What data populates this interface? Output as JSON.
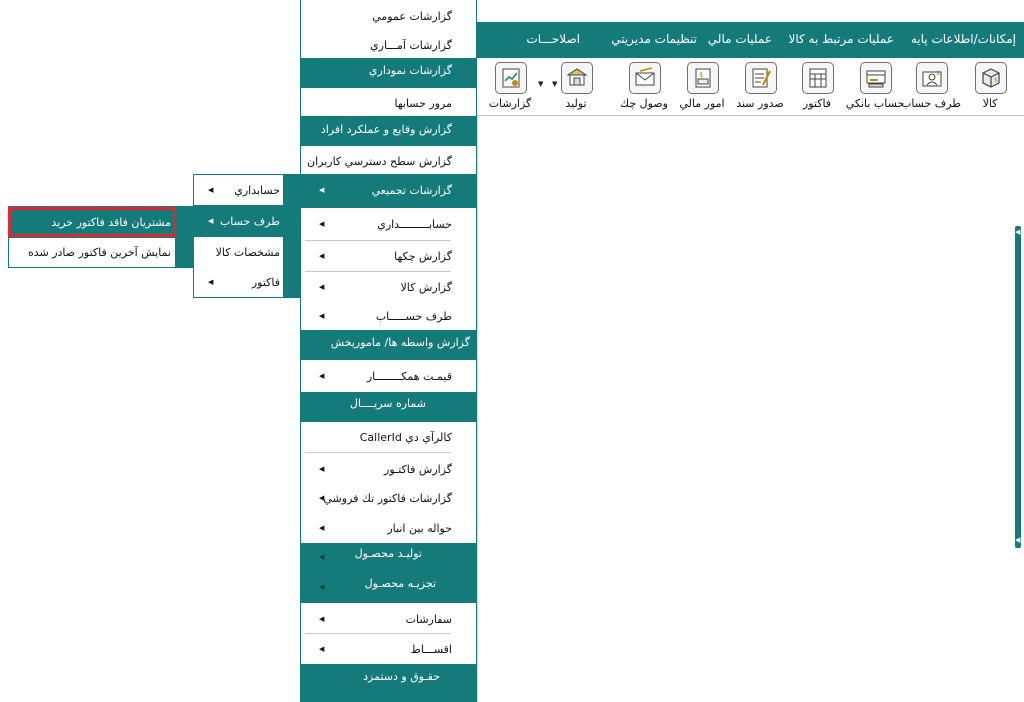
{
  "menubar": {
    "items": [
      "إمكانات/اطلاعات پايه",
      "عمليات مرتبط به كالا",
      "عمليات مالي",
      "تنظيمات مديريتي",
      "اصلاحـــات"
    ]
  },
  "toolbar": {
    "buttons": [
      {
        "label": "كالا",
        "icon": "box-icon"
      },
      {
        "label": "طرف حساب",
        "icon": "person-card-icon"
      },
      {
        "label": "حساب بانكي",
        "icon": "bank-card-icon"
      },
      {
        "label": "فاكتور",
        "icon": "invoice-icon"
      },
      {
        "label": "صدور سند",
        "icon": "document-pen-icon"
      },
      {
        "label": "امور مالي",
        "icon": "finance-icon"
      },
      {
        "label": "وصول چك",
        "icon": "cheque-envelope-icon"
      },
      {
        "label": "توليد",
        "icon": "factory-icon"
      },
      {
        "label": "گزارشات",
        "icon": "report-chart-icon"
      }
    ]
  },
  "reports_menu": {
    "items": [
      {
        "label": "گزارشات عمومي"
      },
      {
        "label": "گزارشات آمـــاري"
      },
      {
        "label": "گزارشات نموداري"
      },
      {
        "label": "مرور حسابها"
      },
      {
        "label": "گزارش وقايع و عملكرد افراد"
      },
      {
        "label": "گزارش سطح دسترسي كاربران"
      },
      {
        "label": "گزارشات تجميعي"
      },
      {
        "label": "حسابـــــــــداري"
      },
      {
        "label": "گزارش چكها"
      },
      {
        "label": "گزارش كالا"
      },
      {
        "label": "طرف حســـــاب"
      },
      {
        "label": "گزارش واسطه ها/ ماموريخش"
      },
      {
        "label": "قيمـت همكــــــــار"
      },
      {
        "label": "شماره سريــــال"
      },
      {
        "label": "كالرآي دي CallerId"
      },
      {
        "label": "گزارش فاكتـور"
      },
      {
        "label": "گزارشات فاكتور تك فروشي"
      },
      {
        "label": "حواله بين انبار"
      },
      {
        "label": "توليـد محصـول"
      },
      {
        "label": "تجزيـه محصـول"
      },
      {
        "label": "سفارشات"
      },
      {
        "label": "اقســـاط"
      },
      {
        "label": "حقـوق و دستمزد"
      }
    ]
  },
  "submenu_level2": {
    "items": [
      {
        "label": "حسابداري"
      },
      {
        "label": "طرف حساب"
      },
      {
        "label": "مشخصات كالا"
      },
      {
        "label": "فاكتور"
      }
    ]
  },
  "submenu_level3": {
    "items": [
      {
        "label": "مشتريان فاقد فاكتور خريد"
      },
      {
        "label": "نمايش آخرين فاكتور صادر شده"
      }
    ]
  },
  "colors": {
    "accent": "#157a7a",
    "highlight_border": "#e0262e"
  }
}
